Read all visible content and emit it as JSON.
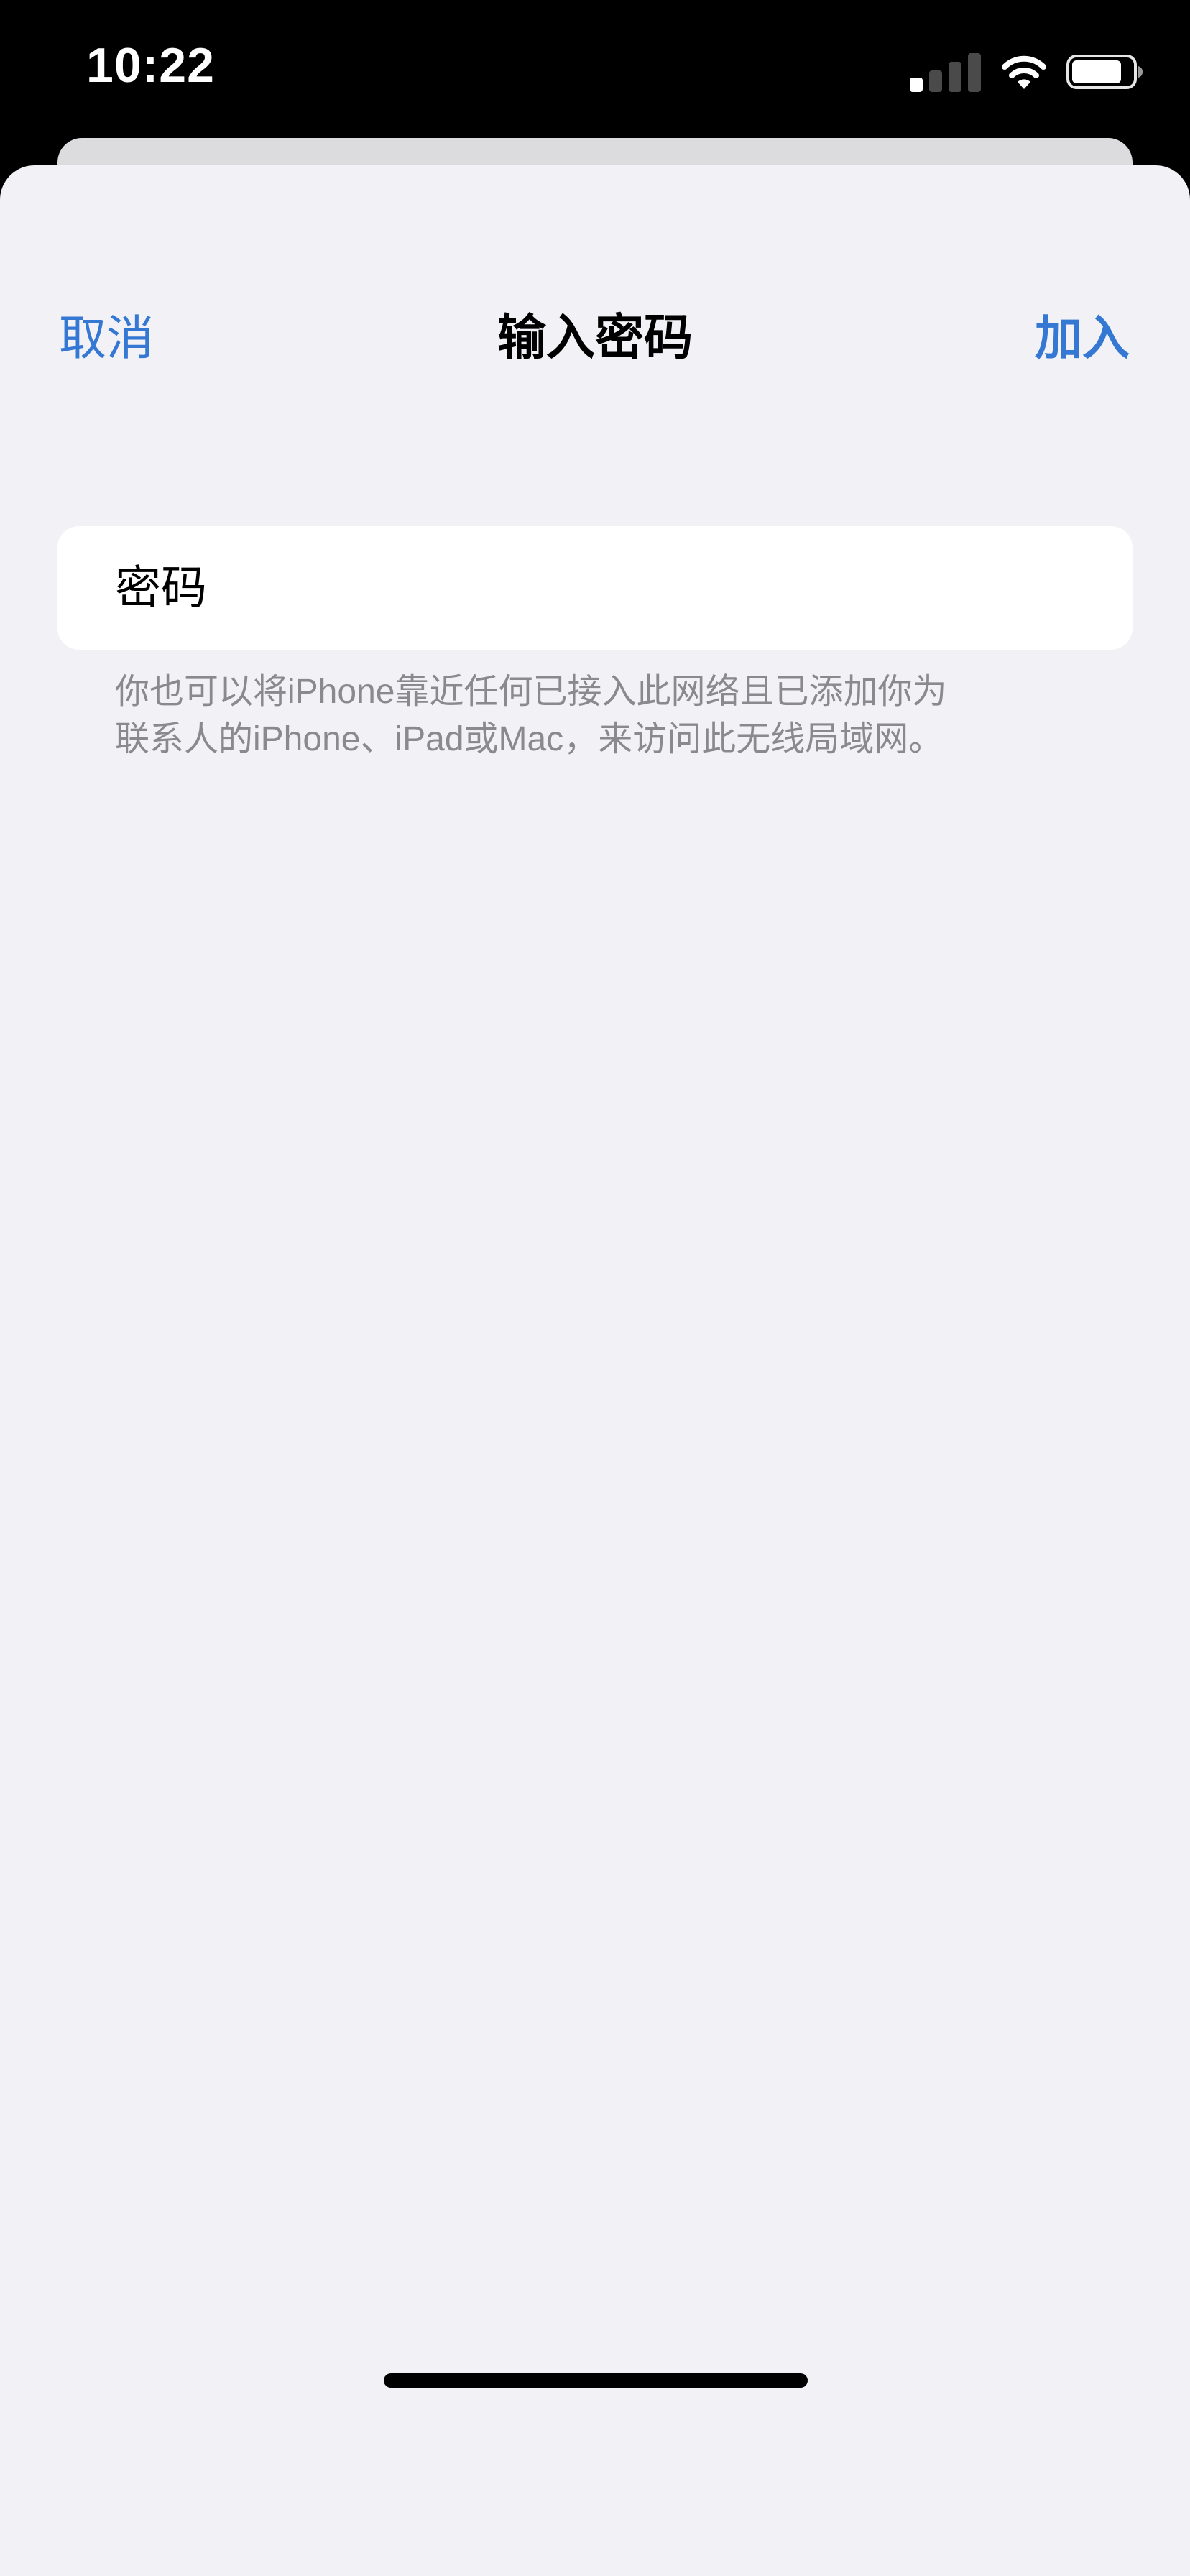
{
  "status_bar": {
    "time": "10:22",
    "icons": [
      "cellular-signal-icon",
      "wifi-icon",
      "battery-icon"
    ]
  },
  "nav": {
    "cancel_label": "取消",
    "title": "输入密码",
    "join_label": "加入"
  },
  "password_field": {
    "placeholder": "密码",
    "value": ""
  },
  "footnote": {
    "line1": "你也可以将iPhone靠近任何已接入此网络且已添加你为",
    "line2": "联系人的iPhone、iPad或Mac，来访问此无线局域网。"
  },
  "colors": {
    "accent": "#3478d4",
    "sheet_background": "#f1f1f6",
    "footnote_text": "#8a8a8e"
  }
}
